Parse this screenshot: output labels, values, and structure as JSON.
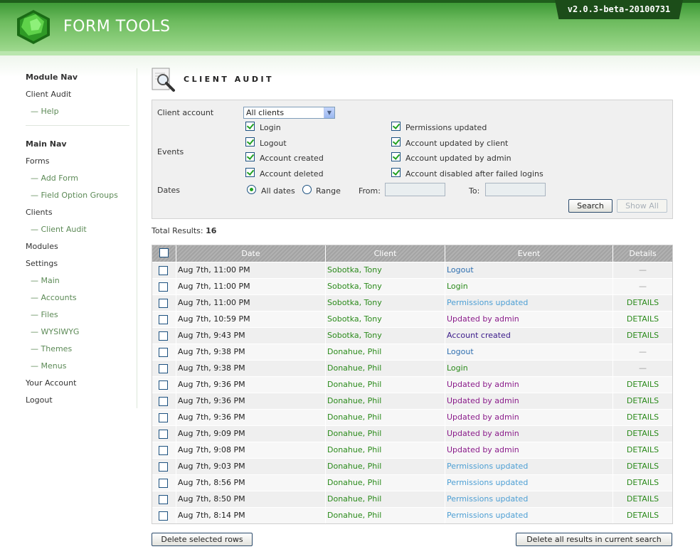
{
  "header": {
    "logo_text": "FORM TOOLS",
    "version": "v2.0.3-beta-20100731"
  },
  "sidebar": {
    "module_nav_heading": "Module Nav",
    "module_items": [
      {
        "label": "Client Audit",
        "level": 0
      },
      {
        "label": "— Help",
        "level": 1
      }
    ],
    "main_nav_heading": "Main Nav",
    "main_items": [
      {
        "label": "Forms",
        "level": 0
      },
      {
        "label": "— Add Form",
        "level": 1
      },
      {
        "label": "— Field Option Groups",
        "level": 1
      },
      {
        "label": "Clients",
        "level": 0
      },
      {
        "label": "— Client Audit",
        "level": 1
      },
      {
        "label": "Modules",
        "level": 0
      },
      {
        "label": "Settings",
        "level": 0
      },
      {
        "label": "— Main",
        "level": 1
      },
      {
        "label": "— Accounts",
        "level": 1
      },
      {
        "label": "— Files",
        "level": 1
      },
      {
        "label": "— WYSIWYG",
        "level": 1
      },
      {
        "label": "— Themes",
        "level": 1
      },
      {
        "label": "— Menus",
        "level": 1
      },
      {
        "label": "Your Account",
        "level": 0
      },
      {
        "label": "Logout",
        "level": 0
      }
    ]
  },
  "page": {
    "title": "CLIENT AUDIT"
  },
  "search": {
    "client_account_label": "Client account",
    "client_account_value": "All clients",
    "events_label": "Events",
    "events_left": [
      {
        "label": "Login",
        "checked": true
      },
      {
        "label": "Logout",
        "checked": true
      },
      {
        "label": "Account created",
        "checked": true
      },
      {
        "label": "Account deleted",
        "checked": true
      }
    ],
    "events_right": [
      {
        "label": "Permissions updated",
        "checked": true
      },
      {
        "label": "Account updated by client",
        "checked": true
      },
      {
        "label": "Account updated by admin",
        "checked": true
      },
      {
        "label": "Account disabled after failed logins",
        "checked": true
      }
    ],
    "dates_label": "Dates",
    "all_dates_label": "All dates",
    "range_label": "Range",
    "from_label": "From:",
    "to_label": "To:",
    "from_value": "",
    "to_value": "",
    "search_button": "Search",
    "show_all_button": "Show All"
  },
  "results": {
    "total_label": "Total Results:",
    "total_value": "16",
    "columns": [
      "",
      "Date",
      "Client",
      "Event",
      "Details"
    ],
    "event_colors": {
      "Logout": "#2f6fb0",
      "Login": "#2a8a1a",
      "Permissions updated": "#4d9fd4",
      "Updated by admin": "#8a1a8a",
      "Account created": "#3a1a8a"
    },
    "rows": [
      {
        "date": "Aug 7th, 11:00 PM",
        "client": "Sobotka, Tony",
        "event": "Logout",
        "details": "—"
      },
      {
        "date": "Aug 7th, 11:00 PM",
        "client": "Sobotka, Tony",
        "event": "Login",
        "details": "—"
      },
      {
        "date": "Aug 7th, 11:00 PM",
        "client": "Sobotka, Tony",
        "event": "Permissions updated",
        "details": "DETAILS"
      },
      {
        "date": "Aug 7th, 10:59 PM",
        "client": "Sobotka, Tony",
        "event": "Updated by admin",
        "details": "DETAILS"
      },
      {
        "date": "Aug 7th, 9:43 PM",
        "client": "Sobotka, Tony",
        "event": "Account created",
        "details": "DETAILS"
      },
      {
        "date": "Aug 7th, 9:38 PM",
        "client": "Donahue, Phil",
        "event": "Logout",
        "details": "—"
      },
      {
        "date": "Aug 7th, 9:38 PM",
        "client": "Donahue, Phil",
        "event": "Login",
        "details": "—"
      },
      {
        "date": "Aug 7th, 9:36 PM",
        "client": "Donahue, Phil",
        "event": "Updated by admin",
        "details": "DETAILS"
      },
      {
        "date": "Aug 7th, 9:36 PM",
        "client": "Donahue, Phil",
        "event": "Updated by admin",
        "details": "DETAILS"
      },
      {
        "date": "Aug 7th, 9:36 PM",
        "client": "Donahue, Phil",
        "event": "Updated by admin",
        "details": "DETAILS"
      },
      {
        "date": "Aug 7th, 9:09 PM",
        "client": "Donahue, Phil",
        "event": "Updated by admin",
        "details": "DETAILS"
      },
      {
        "date": "Aug 7th, 9:08 PM",
        "client": "Donahue, Phil",
        "event": "Updated by admin",
        "details": "DETAILS"
      },
      {
        "date": "Aug 7th, 9:03 PM",
        "client": "Donahue, Phil",
        "event": "Permissions updated",
        "details": "DETAILS"
      },
      {
        "date": "Aug 7th, 8:56 PM",
        "client": "Donahue, Phil",
        "event": "Permissions updated",
        "details": "DETAILS"
      },
      {
        "date": "Aug 7th, 8:50 PM",
        "client": "Donahue, Phil",
        "event": "Permissions updated",
        "details": "DETAILS"
      },
      {
        "date": "Aug 7th, 8:14 PM",
        "client": "Donahue, Phil",
        "event": "Permissions updated",
        "details": "DETAILS"
      }
    ]
  },
  "footer": {
    "delete_selected": "Delete selected rows",
    "delete_all": "Delete all results in current search"
  }
}
